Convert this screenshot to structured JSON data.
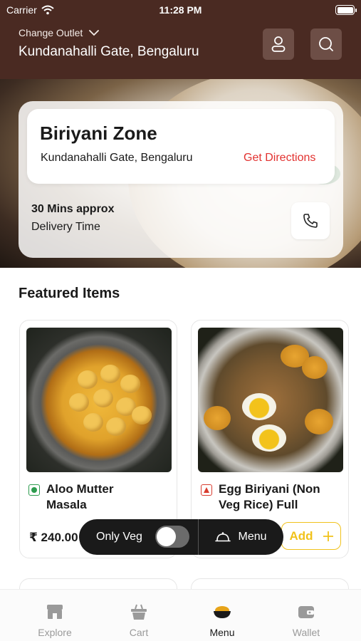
{
  "status_bar": {
    "carrier": "Carrier",
    "time": "11:28 PM"
  },
  "header": {
    "change_outlet_label": "Change Outlet",
    "outlet_location": "Kundanahalli Gate, Bengaluru"
  },
  "restaurant": {
    "name": "Biriyani Zone",
    "location": "Kundanahalli Gate, Bengaluru",
    "directions_label": "Get Directions",
    "delivery_eta": "30 Mins approx",
    "delivery_label": "Delivery Time"
  },
  "featured": {
    "title": "Featured Items",
    "items": [
      {
        "name_line1": "Aloo Mutter",
        "name_line2": "Masala",
        "type": "veg",
        "price": "₹ 240.00"
      },
      {
        "name_line1": "Egg Biriyani (Non",
        "name_line2": "Veg Rice) Full",
        "type": "non-veg",
        "add_label": "Add"
      }
    ]
  },
  "floating_bar": {
    "only_veg_label": "Only Veg",
    "only_veg_enabled": false,
    "menu_label": "Menu"
  },
  "bottom_nav": {
    "tabs": [
      {
        "label": "Explore",
        "icon": "store-icon"
      },
      {
        "label": "Cart",
        "icon": "basket-icon"
      },
      {
        "label": "Menu",
        "icon": "bowl-icon",
        "active": true
      },
      {
        "label": "Wallet",
        "icon": "wallet-icon"
      }
    ]
  },
  "colors": {
    "header_bg": "#4a2a22",
    "accent_red": "#e2312f",
    "add_yellow": "#f1c21b",
    "veg_green": "#2d9b4e",
    "nonveg_red": "#d83b2e"
  }
}
